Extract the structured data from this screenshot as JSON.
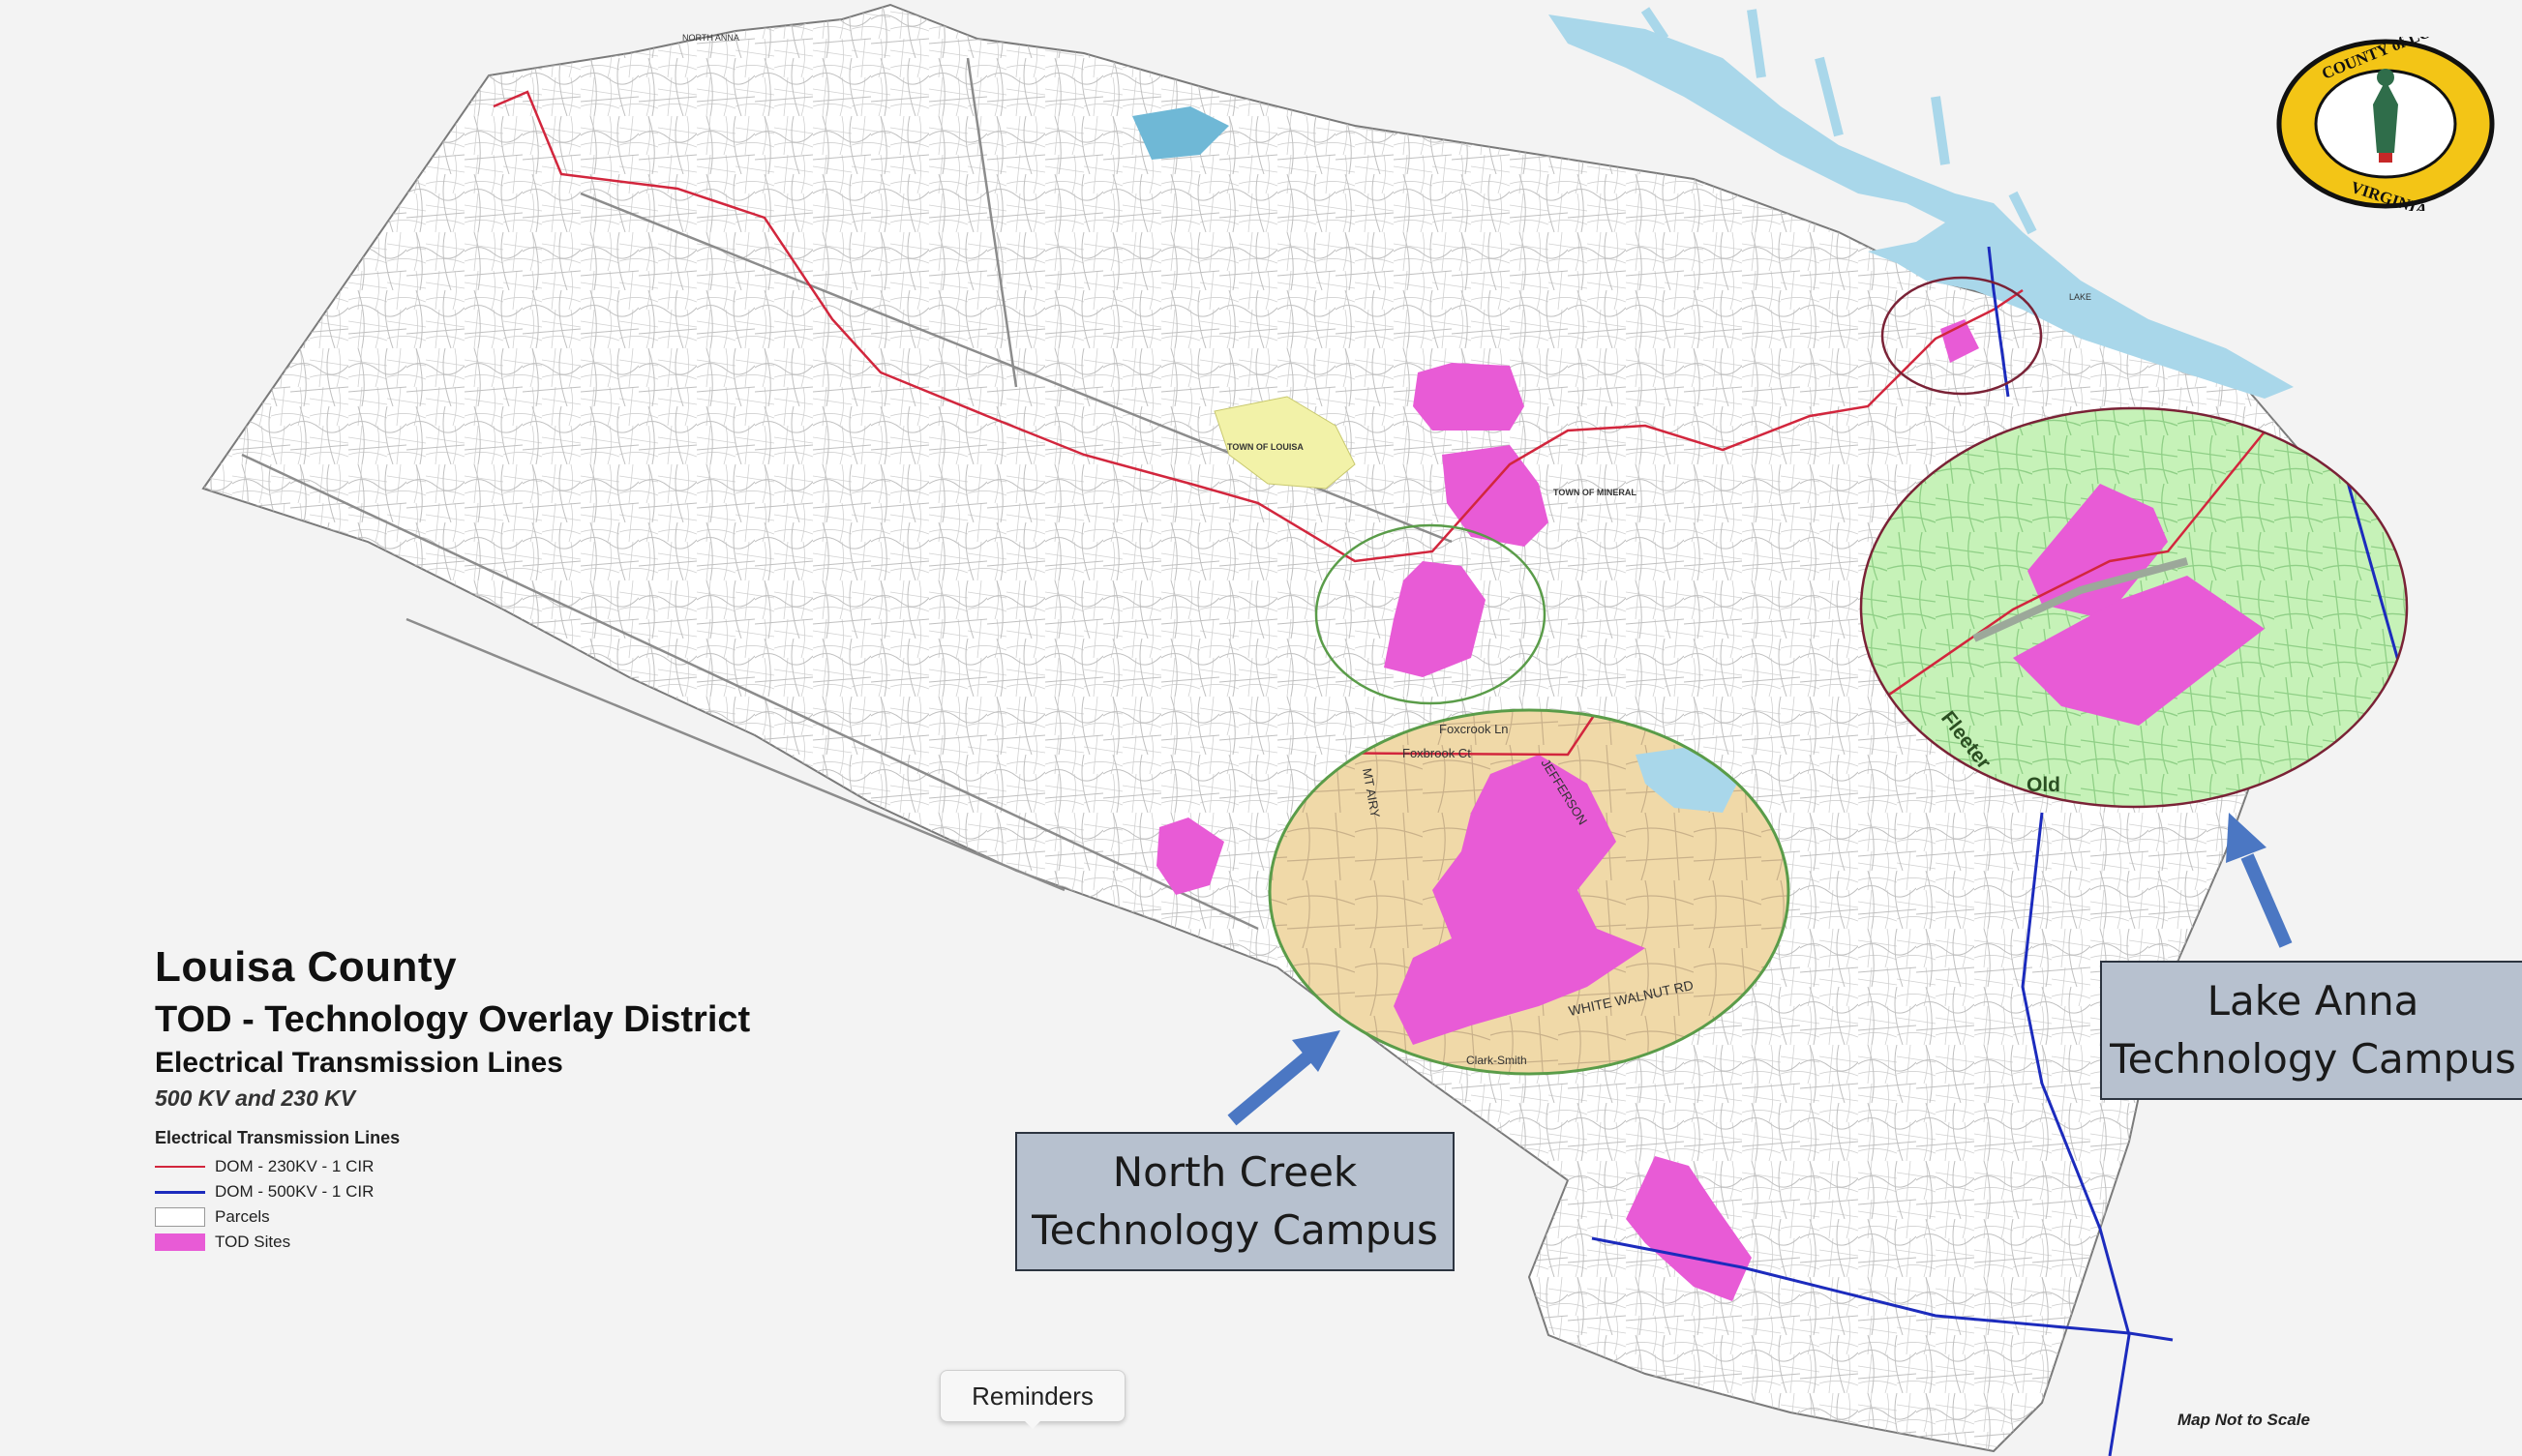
{
  "title": {
    "line1": "Louisa County",
    "line2": "TOD - Technology Overlay District",
    "line3": "Electrical Transmission Lines",
    "line4": "500 KV   and   230 KV"
  },
  "legend": {
    "heading": "Electrical Transmission Lines",
    "items": [
      {
        "label": "DOM - 230KV - 1 CIR",
        "color": "#d2263d"
      },
      {
        "label": "DOM - 500KV - 1 CIR",
        "color": "#1c2bbd"
      },
      {
        "label": "Parcels",
        "color": "#ffffff"
      },
      {
        "label": "TOD Sites",
        "color": "#e85bd6"
      }
    ]
  },
  "callouts": {
    "north_creek": [
      "North Creek",
      "Technology Campus"
    ],
    "lake_anna": [
      "Lake Anna",
      "Technology Campus"
    ]
  },
  "map_labels": {
    "town_louisa": "TOWN OF LOUISA",
    "town_mineral": "TOWN OF MINERAL",
    "north_anna": "NORTH ANNA",
    "lake": "LAKE",
    "north_inset_streets": [
      "Foxcrook Ln",
      "Foxbrook Ct",
      "MT AIRY",
      "JEFFERSON",
      "WHITE WALNUT RD",
      "Clark-Smith"
    ],
    "lake_inset_streets": [
      "Fleeter",
      "Old"
    ]
  },
  "seal": {
    "text_top": "COUNTY of LOUISA",
    "text_bottom": "VIRGINIA"
  },
  "map_note": "Map Not to Scale",
  "tooltip": "Reminders",
  "colors": {
    "tod_site": "#e85bd6",
    "line_230kv": "#d2263d",
    "line_500kv": "#1c2bbd",
    "lake_water": "#a9d7ea",
    "town_louisa": "#f2f2a8",
    "north_inset_bg": "#f0d9a8",
    "lake_inset_bg": "#c6f2b8"
  }
}
